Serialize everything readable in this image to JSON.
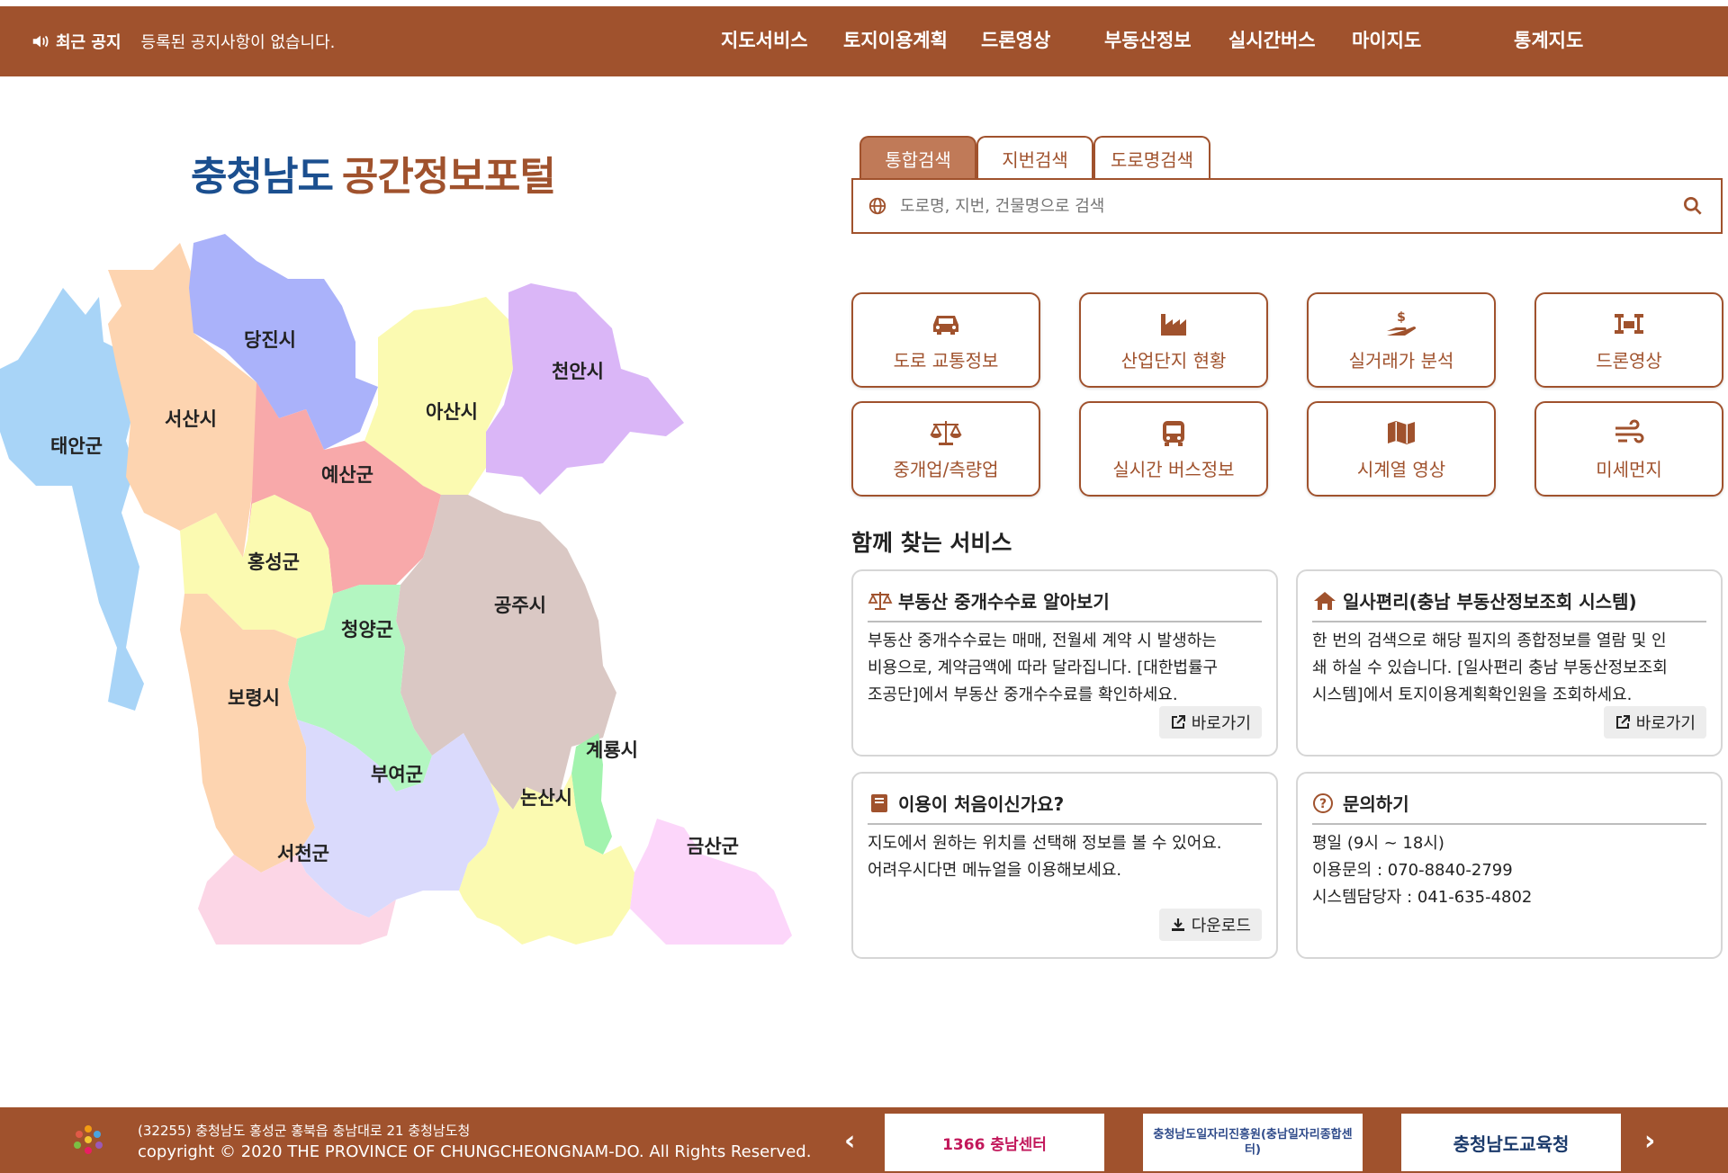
{
  "header": {
    "notice_label": "최근 공지",
    "notice_text": "등록된 공지사항이 없습니다.",
    "nav": [
      "지도서비스",
      "토지이용계획",
      "드론영상",
      "부동산정보",
      "실시간버스",
      "마이지도",
      "통계지도"
    ]
  },
  "brand": {
    "part1": "충청남도",
    "part2": "공간정보포털"
  },
  "map": {
    "regions": [
      "당진시",
      "서산시",
      "태안군",
      "아산시",
      "천안시",
      "예산군",
      "홍성군",
      "공주시",
      "청양군",
      "보령시",
      "계룡시",
      "부여군",
      "논산시",
      "금산군",
      "서천군"
    ]
  },
  "search": {
    "tabs": [
      "통합검색",
      "지번검색",
      "도로명검색"
    ],
    "active_tab": "통합검색",
    "placeholder": "도로명, 지번, 건물명으로 검색"
  },
  "quick": [
    {
      "label": "도로 교통정보",
      "icon": "car-icon"
    },
    {
      "label": "산업단지 현황",
      "icon": "factory-icon"
    },
    {
      "label": "실거래가 분석",
      "icon": "money-hand-icon"
    },
    {
      "label": "드론영상",
      "icon": "drone-icon"
    },
    {
      "label": "중개업/측량업",
      "icon": "scale-icon"
    },
    {
      "label": "실시간 버스정보",
      "icon": "bus-icon"
    },
    {
      "label": "시계열 영상",
      "icon": "map-icon"
    },
    {
      "label": "미세먼지",
      "icon": "wind-icon"
    }
  ],
  "services": {
    "title": "함께 찾는 서비스",
    "cards": [
      {
        "title": "부동산 중개수수료 알아보기",
        "lines": [
          "부동산 중개수수료는 매매, 전월세 계약 시 발생하는",
          "비용으로, 계약금액에 따라 달라집니다. [대한법률구",
          "조공단]에서 부동산 중개수수료를 확인하세요."
        ],
        "action": "바로가기",
        "icon": "scale-icon"
      },
      {
        "title": "일사편리(충남 부동산정보조회 시스템)",
        "lines": [
          "한 번의 검색으로 해당 필지의 종합정보를 열람 및 인",
          "쇄 하실 수 있습니다. [일사편리 충남 부동산정보조회",
          "시스템]에서 토지이용계획확인원을 조회하세요."
        ],
        "action": "바로가기",
        "icon": "home-icon"
      },
      {
        "title": "이용이 처음이신가요?",
        "lines": [
          "지도에서 원하는 위치를 선택해 정보를 볼 수 있어요.",
          "어려우시다면 메뉴얼을 이용해보세요."
        ],
        "action": "다운로드",
        "icon": "book-icon"
      },
      {
        "title": "문의하기",
        "lines": [
          "평일 (9시 ~ 18시)",
          "이용문의 : 070-8840-2799",
          "시스템담당자 : 041-635-4802"
        ],
        "action": "",
        "icon": "question-icon"
      }
    ]
  },
  "footer": {
    "address": "(32255) 충청남도 홍성군 홍북읍 충남대로 21 충청남도청",
    "copyright": "copyright © 2020 THE PROVINCE OF CHUNGCHEONGNAM-DO. All Rights Reserved.",
    "banners": [
      "1366 충남센터",
      "충청남도일자리진흥원(충남일자리종합센터)",
      "충청남도교육청"
    ]
  },
  "colors": {
    "primary": "#a0522d",
    "brand_blue": "#1b4f8f"
  }
}
